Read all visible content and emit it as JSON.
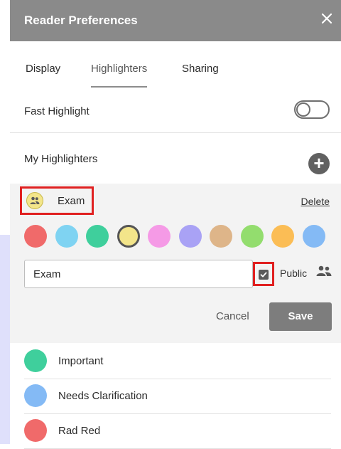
{
  "panel": {
    "title": "Reader Preferences",
    "close_icon": "close-icon"
  },
  "tabs": [
    {
      "label": "Display",
      "active": false
    },
    {
      "label": "Highlighters",
      "active": true
    },
    {
      "label": "Sharing",
      "active": false
    }
  ],
  "fast_highlight": {
    "label": "Fast Highlight",
    "enabled": false
  },
  "my_highlighters": {
    "label": "My Highlighters",
    "add_icon": "plus-icon"
  },
  "editor": {
    "current": {
      "name": "Exam",
      "color": "#f3e58a",
      "icon": "people-icon"
    },
    "delete_label": "Delete",
    "colors": [
      "#f06a6a",
      "#7fd3f2",
      "#3fcf9c",
      "#f3e58a",
      "#f59ae6",
      "#a9a2f5",
      "#deb589",
      "#93dd6e",
      "#fbbd55",
      "#84baf5"
    ],
    "selected_color": "#f3e58a",
    "name_value": "Exam",
    "public_checked": true,
    "public_label": "Public",
    "public_icon": "people-icon",
    "cancel_label": "Cancel",
    "save_label": "Save"
  },
  "list": [
    {
      "label": "Important",
      "color": "#3fcf9c"
    },
    {
      "label": "Needs Clarification",
      "color": "#84baf5"
    },
    {
      "label": "Rad Red",
      "color": "#f06a6a"
    }
  ]
}
